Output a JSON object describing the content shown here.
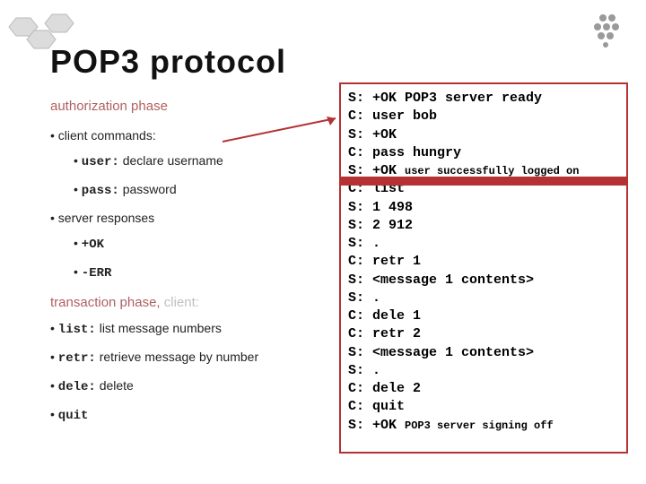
{
  "title": "POP3 protocol",
  "left": {
    "auth_heading": "authorization phase",
    "client_commands_label": "client commands:",
    "user_cmd": "user:",
    "user_desc": " declare username",
    "pass_cmd": "pass:",
    "pass_desc": " password",
    "server_responses_label": "server responses",
    "ok": "+OK",
    "err": "-ERR",
    "txn_heading": "transaction phase,",
    "txn_client": " client:",
    "list_cmd": "list:",
    "list_desc": " list message numbers",
    "retr_cmd": "retr:",
    "retr_desc": " retrieve message by number",
    "dele_cmd": "dele:",
    "dele_desc": " delete",
    "quit_cmd": "quit"
  },
  "panel": {
    "l1a": "S: +OK POP3 server ready",
    "l2": "C: user bob",
    "l3": "S: +OK",
    "l4": "C: pass hungry",
    "l5a": "S: +OK ",
    "l5b": "user successfully logged on",
    "l6": "C: list",
    "l7": "S: 1 498",
    "l8": "S: 2 912",
    "l9": "S: .",
    "l10": "C: retr 1",
    "l11": "S: <message 1 contents>",
    "l12": "S: .",
    "l13": "C: dele 1",
    "l14": "C: retr 2",
    "l15": "S: <message 1 contents>",
    "l16": "S: .",
    "l17": "C: dele 2",
    "l18": "C: quit",
    "l19a": "S: +OK ",
    "l19b": "POP3 server signing off"
  }
}
